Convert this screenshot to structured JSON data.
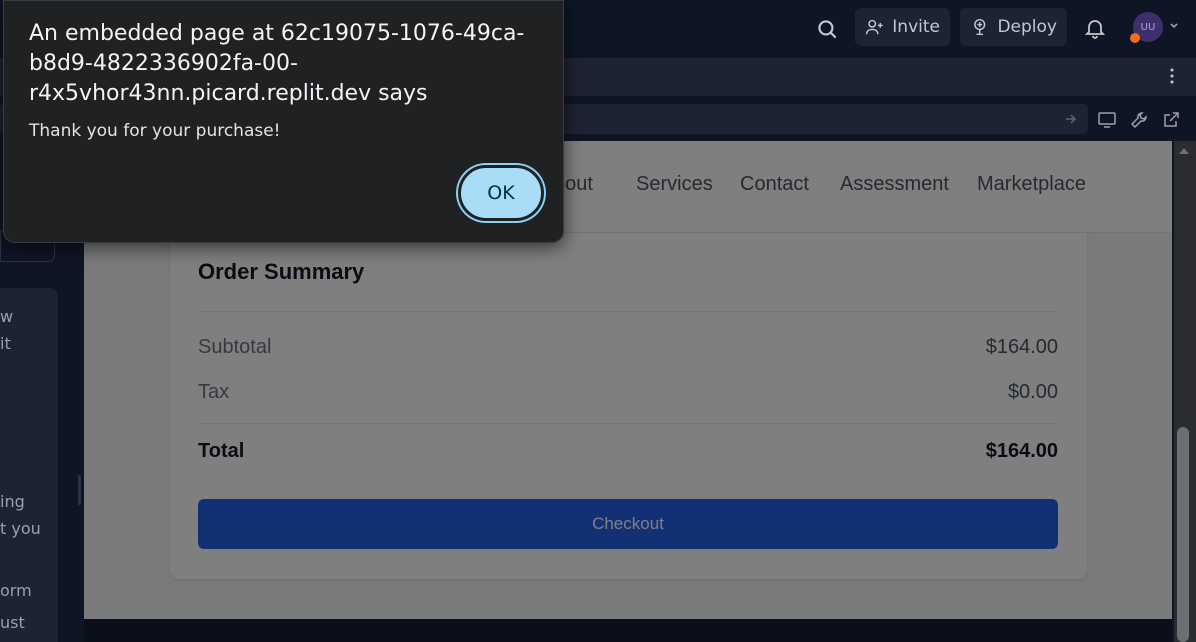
{
  "topbar": {
    "invite_label": "Invite",
    "deploy_label": "Deploy",
    "avatar_initials": "UU"
  },
  "sidebar": {
    "text_fragments": [
      "w",
      "it",
      "ing",
      "t you",
      "orm",
      "ust"
    ]
  },
  "webview": {
    "nav": {
      "items": [
        "bout",
        "Services",
        "Contact",
        "Assessment",
        "Marketplace"
      ]
    },
    "order_summary": {
      "title": "Order Summary",
      "subtotal_label": "Subtotal",
      "subtotal_value": "$164.00",
      "tax_label": "Tax",
      "tax_value": "$0.00",
      "total_label": "Total",
      "total_value": "$164.00",
      "checkout_label": "Checkout"
    }
  },
  "dialog": {
    "title": "An embedded page at 62c19075-1076-49ca-b8d9-4822336902fa-00-r4x5vhor43nn.picard.replit.dev says",
    "title_lines": [
      "An embedded page at 62c19075-1076-49ca-",
      "b8d9-4822336902fa-00-",
      "r4x5vhor43nn.picard.replit.dev says"
    ],
    "message": "Thank you for your purchase!",
    "ok_label": "OK"
  },
  "colors": {
    "ide_background": "#0e1525",
    "panel": "#1c2333",
    "checkout_button": "#2563eb",
    "ok_button": "#a8dcf7",
    "avatar_badge": "#f26b1d"
  }
}
